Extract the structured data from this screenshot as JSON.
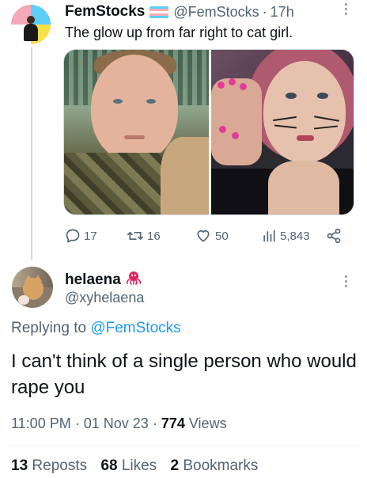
{
  "tweet": {
    "author_name": "FemStocks",
    "author_handle": "@FemStocks",
    "separator": "·",
    "time": "17h",
    "text": "The glow up from far right to cat girl.",
    "flag_colors": [
      "#5bcefa",
      "#f5a9b8",
      "#ffffff",
      "#f5a9b8",
      "#5bcefa"
    ],
    "actions": {
      "replies": "17",
      "reposts": "16",
      "likes": "50",
      "views": "5,843"
    }
  },
  "reply": {
    "author_name": "helaena",
    "author_emoji_icon": "octopus-icon",
    "author_handle": "@xyhelaena",
    "replying_prefix": "Replying to",
    "replying_to": "@FemStocks",
    "text": "I can't think of a single person who would rape you",
    "time": "11:00 PM",
    "date": "01 Nov 23",
    "views_count": "774",
    "views_label": "Views",
    "reposts_count": "13",
    "reposts_label": "Reposts",
    "likes_count": "68",
    "likes_label": "Likes",
    "bookmarks_count": "2",
    "bookmarks_label": "Bookmarks"
  },
  "colors": {
    "text_primary": "#0f1419",
    "text_secondary": "#536471",
    "link": "#1d9bf0",
    "thread_line": "#cfd9de"
  }
}
